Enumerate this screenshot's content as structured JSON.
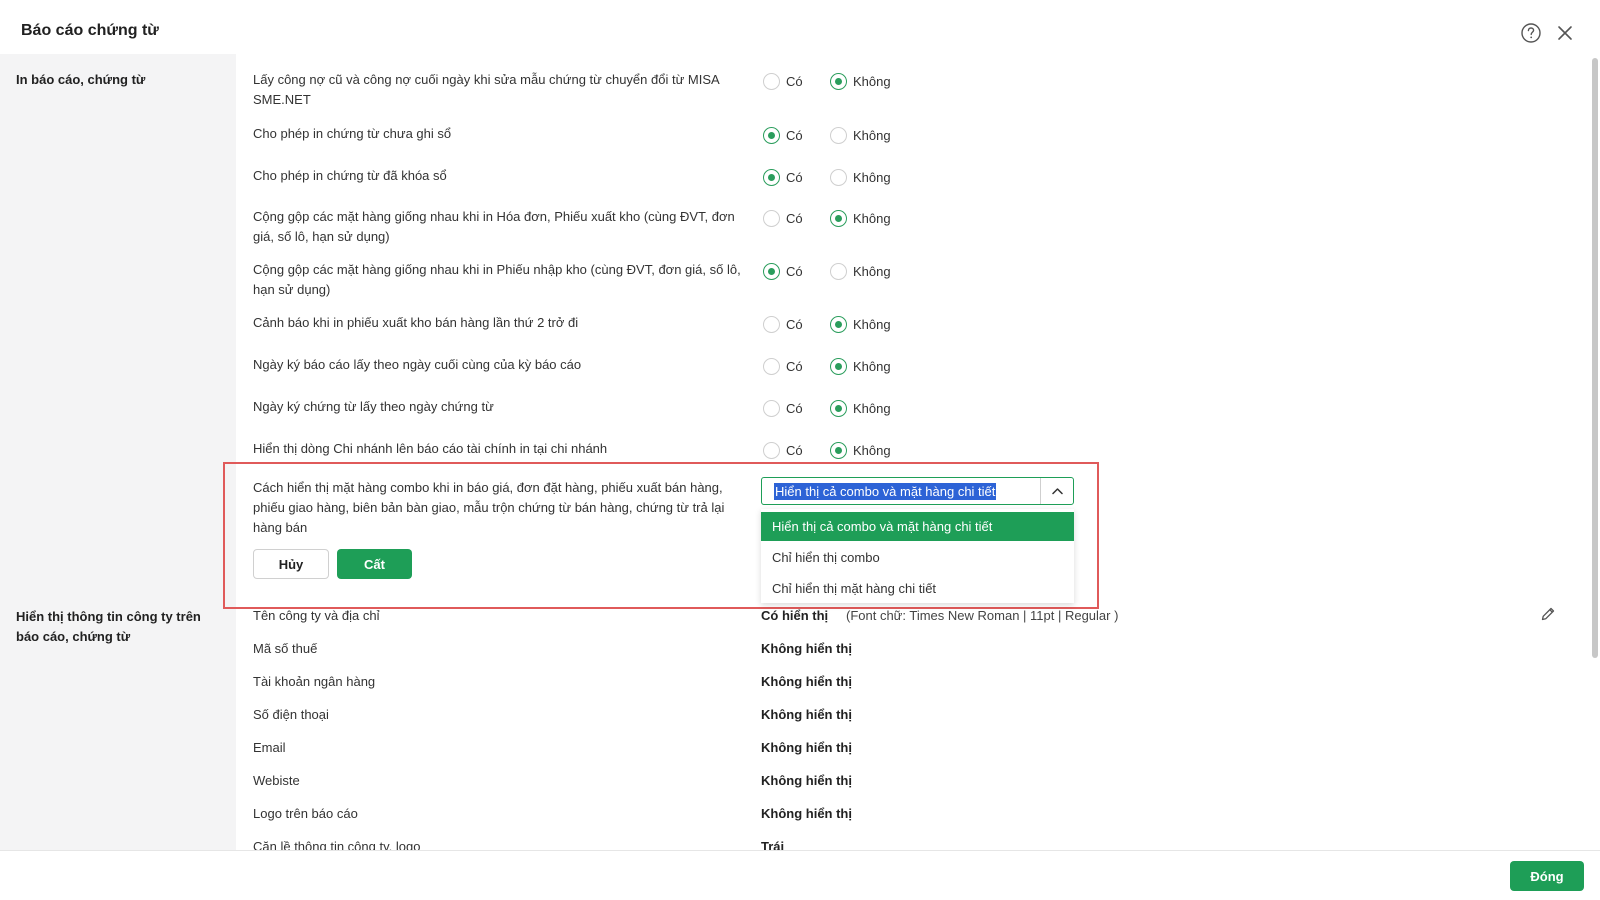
{
  "dialog": {
    "title": "Báo cáo chứng từ",
    "close_label": "Đóng"
  },
  "sections": {
    "print": "In báo cáo, chứng từ",
    "company_info": "Hiển thị thông tin công ty trên báo cáo, chứng từ"
  },
  "radio_options": {
    "yes": "Có",
    "no": "Không"
  },
  "settings": [
    {
      "label": "Lấy công nợ cũ và công nợ cuối ngày khi sửa mẫu chứng từ chuyển đổi từ MISA SME.NET",
      "value": "no"
    },
    {
      "label": "Cho phép in chứng từ chưa ghi sổ",
      "value": "yes"
    },
    {
      "label": "Cho phép in chứng từ đã khóa sổ",
      "value": "yes"
    },
    {
      "label": "Cộng gộp các mặt hàng giống nhau khi in Hóa đơn, Phiếu xuất kho (cùng ĐVT, đơn giá, số lô, hạn sử dụng)",
      "value": "no"
    },
    {
      "label": "Cộng gộp các mặt hàng giống nhau khi in Phiếu nhập kho (cùng ĐVT, đơn giá, số lô, hạn sử dụng)",
      "value": "yes"
    },
    {
      "label": "Cảnh báo khi in phiếu xuất kho bán hàng lần thứ 2 trở đi",
      "value": "no"
    },
    {
      "label": "Ngày ký báo cáo lấy theo ngày cuối cùng của kỳ báo cáo",
      "value": "no"
    },
    {
      "label": "Ngày ký chứng từ lấy theo ngày chứng từ",
      "value": "no"
    },
    {
      "label": "Hiển thị dòng Chi nhánh lên báo cáo tài chính in tại chi nhánh",
      "value": "no"
    }
  ],
  "combo_setting": {
    "label": "Cách hiển thị mặt hàng combo khi in báo giá, đơn đặt hàng, phiếu xuất bán hàng, phiếu giao hàng, biên bản bàn giao, mẫu trộn chứng từ bán hàng, chứng từ trả lại hàng bán",
    "selected": "Hiển thị cả combo và mặt hàng chi tiết",
    "options": [
      "Hiển thị cả combo và mặt hàng chi tiết",
      "Chỉ hiển thị combo",
      "Chỉ hiển thị mặt hàng chi tiết"
    ],
    "cancel_label": "Hủy",
    "save_label": "Cất"
  },
  "company_info": [
    {
      "label": "Tên công ty và địa chỉ",
      "value": "Có hiển thị",
      "extra": "(Font chữ: Times New Roman | 11pt | Regular )"
    },
    {
      "label": "Mã số thuế",
      "value": "Không hiển thị"
    },
    {
      "label": "Tài khoản ngân hàng",
      "value": "Không hiển thị"
    },
    {
      "label": "Số điện thoại",
      "value": "Không hiển thị"
    },
    {
      "label": "Email",
      "value": "Không hiển thị"
    },
    {
      "label": "Webiste",
      "value": "Không hiển thị"
    },
    {
      "label": "Logo trên báo cáo",
      "value": "Không hiển thị"
    },
    {
      "label": "Căn lề thông tin công ty, logo",
      "value": "Trái"
    }
  ],
  "colors": {
    "accent": "#1e9e57",
    "highlight_border": "#e05a5a",
    "selection": "#2d63d6"
  }
}
